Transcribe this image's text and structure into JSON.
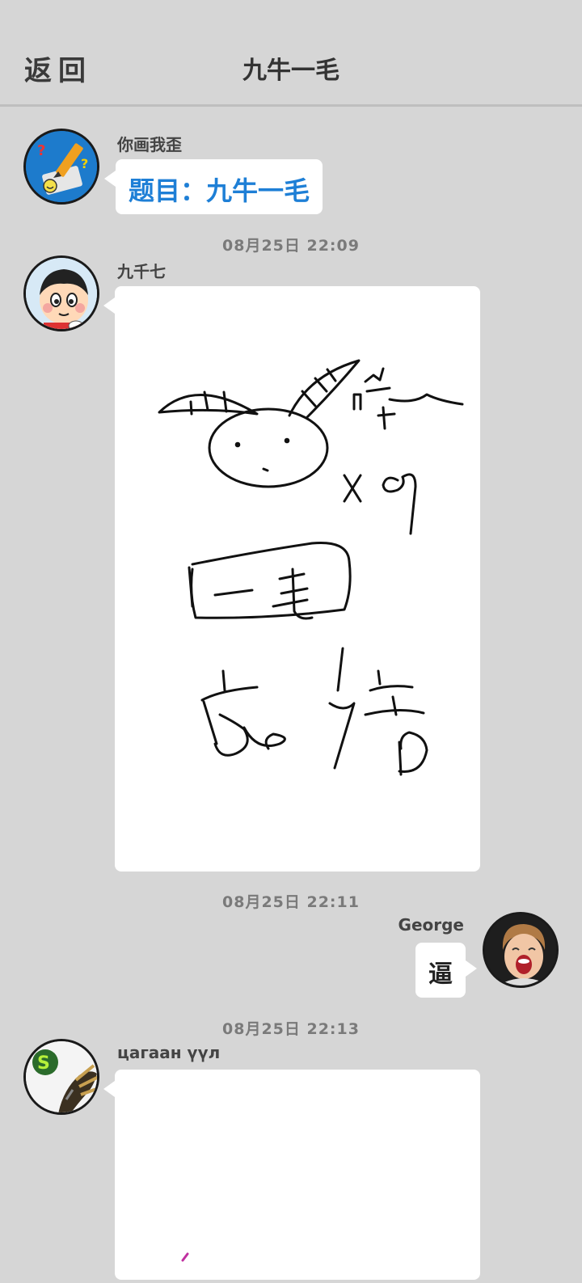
{
  "header": {
    "back_label": "返回",
    "title": "九牛一毛"
  },
  "messages": [
    {
      "sender": "你画我歪",
      "topic_text": "题目：九牛一毛",
      "avatar_icon": "pencil-drawing-game-icon"
    },
    {
      "time": "08月25日  22:09",
      "sender": "九千七",
      "type": "drawing",
      "drawing_content": "sketch of an ox head with horns, text 九牛一毛 and 成语",
      "avatar_icon": "cartoon-boy-avatar"
    },
    {
      "time": "08月25日  22:11",
      "sender": "George",
      "text": "逼",
      "avatar_icon": "screaming-child-avatar"
    },
    {
      "time": "08月25日  22:13",
      "sender": "цагаан үүл",
      "type": "drawing",
      "avatar_icon": "monster-claw-avatar"
    }
  ],
  "colors": {
    "background": "#d6d6d6",
    "topic_blue": "#1e7fd6",
    "bubble": "#ffffff"
  }
}
